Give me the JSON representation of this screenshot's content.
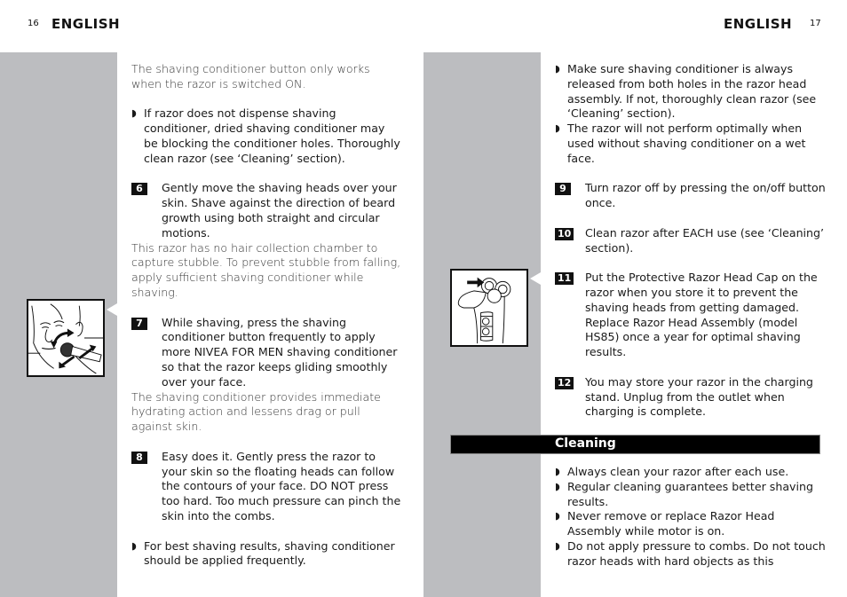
{
  "left_page": {
    "page_number": "16",
    "header": "ENGLISH",
    "intro_note": "The shaving conditioner button only works when the razor is switched ON.",
    "bullet_1": "If razor does not dispense shaving conditioner, dried shaving conditioner may be blocking the conditioner holes. Thoroughly clean razor (see ‘Cleaning’ section).",
    "steps": [
      {
        "number": "6",
        "text": "Gently move the shaving heads over your skin. Shave against the direction of beard growth using both straight and circular motions.",
        "note": "This razor has no hair collection chamber to capture stubble. To prevent stubble from falling, apply sufficient shaving conditioner while shaving."
      },
      {
        "number": "7",
        "text": "While shaving, press the shaving conditioner button frequently to apply more NIVEA FOR MEN shaving conditioner so that the razor keeps gliding smoothly over your face.",
        "note": "The shaving conditioner provides immediate hydrating action and lessens drag or pull against skin."
      },
      {
        "number": "8",
        "text": "Easy does it. Gently press the razor to your skin so the floating heads can follow the contours of your face. DO NOT press too hard. Too much pressure can pinch the skin into the combs."
      }
    ],
    "bullet_2": "For best shaving results, shaving conditioner should be applied frequently.",
    "figure_label": "shaving-motion-illustration"
  },
  "right_page": {
    "page_number": "17",
    "header": "ENGLISH",
    "bullets_top": [
      "Make sure shaving conditioner is always released from both holes in the razor head assembly. If not, thoroughly clean razor (see ‘Cleaning’ section).",
      "The razor will not perform optimally when used without shaving conditioner on a wet face."
    ],
    "steps": [
      {
        "number": "9",
        "text": "Turn razor off by pressing the on/off button once."
      },
      {
        "number": "10",
        "text": "Clean razor after EACH use (see ‘Cleaning’ section)."
      },
      {
        "number": "11",
        "text": "Put the Protective Razor Head Cap on the razor when you store it to prevent the shaving heads from getting damaged. Replace Razor Head Assembly (model HS85) once a year for optimal shaving results."
      },
      {
        "number": "12",
        "text": "You may store your razor in the charging stand. Unplug from the outlet when charging is complete."
      }
    ],
    "section_title": "Cleaning",
    "cleaning_bullets": [
      "Always clean your razor after each use.",
      "Regular cleaning guarantees better shaving results.",
      "Never remove or replace Razor Head Assembly while motor is on.",
      "Do not apply pressure to combs.  Do not touch razor heads with hard objects as this"
    ],
    "figure_label": "razor-head-cap-illustration"
  },
  "icons": {
    "bullet": "◗"
  }
}
